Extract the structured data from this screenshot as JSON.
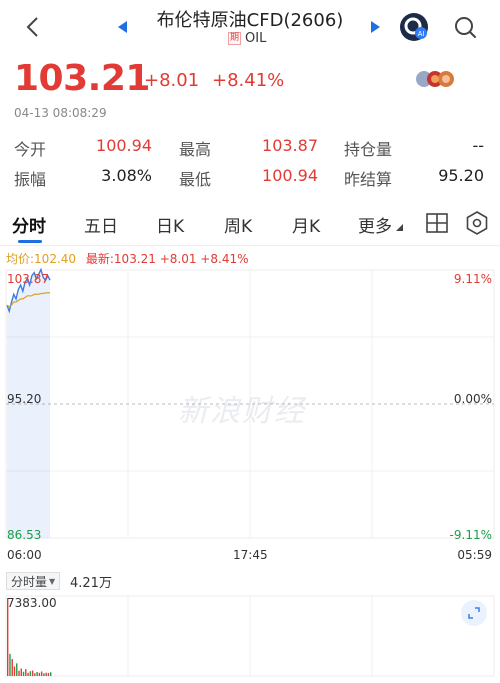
{
  "header": {
    "title": "布伦特原油CFD(2606)",
    "badge": "期",
    "code": "OIL"
  },
  "quote": {
    "price": "103.21",
    "change": "+8.01",
    "change_pct": "+8.41%",
    "timestamp": "04-13 08:08:29"
  },
  "stats": {
    "open_label": "今开",
    "open": "100.94",
    "high_label": "最高",
    "high": "103.87",
    "oi_label": "持仓量",
    "oi": "--",
    "amp_label": "振幅",
    "amp": "3.08%",
    "low_label": "最低",
    "low": "100.94",
    "prev_label": "昨结算",
    "prev": "95.20"
  },
  "tabs": [
    "分时",
    "五日",
    "日K",
    "周K",
    "月K",
    "更多"
  ],
  "chart": {
    "legend_avg": "均价:102.40",
    "legend_latest": "最新:103.21 +8.01 +8.41%",
    "y_top": "103.87",
    "y_mid": "95.20",
    "y_bot": "86.53",
    "pct_top": "9.11%",
    "pct_mid": "0.00%",
    "pct_bot": "-9.11%",
    "x_start": "06:00",
    "x_mid": "17:45",
    "x_end": "05:59",
    "watermark": "新浪财经"
  },
  "chart_data": {
    "type": "line",
    "ylim": [
      86.53,
      103.87
    ],
    "baseline": 95.2,
    "series": [
      {
        "name": "最新",
        "values": [
          101.6,
          101.2,
          101.8,
          102.3,
          102.0,
          102.6,
          102.9,
          102.5,
          103.1,
          103.3,
          102.9,
          103.5,
          103.7,
          103.3,
          103.6,
          103.9,
          103.4,
          103.2,
          103.5,
          103.21
        ]
      },
      {
        "name": "均价",
        "values": [
          101.6,
          101.5,
          101.6,
          101.8,
          101.8,
          101.9,
          102.0,
          102.0,
          102.1,
          102.2,
          102.2,
          102.2,
          102.3,
          102.3,
          102.3,
          102.35,
          102.35,
          102.38,
          102.4,
          102.4
        ]
      }
    ],
    "volume_max": "7383.00",
    "volume": [
      7383,
      2100,
      1600,
      900,
      1200,
      500,
      700,
      400,
      650,
      300,
      450,
      520,
      260,
      380,
      300,
      420,
      250,
      310,
      280,
      350
    ]
  },
  "volume": {
    "selector_label": "分时量",
    "total": "4.21万",
    "max_label": "7383.00"
  },
  "colors": {
    "up": "#e23a34",
    "down": "#1a9e4a",
    "accent": "#1f6fe0",
    "avg_line": "#e0a020"
  }
}
